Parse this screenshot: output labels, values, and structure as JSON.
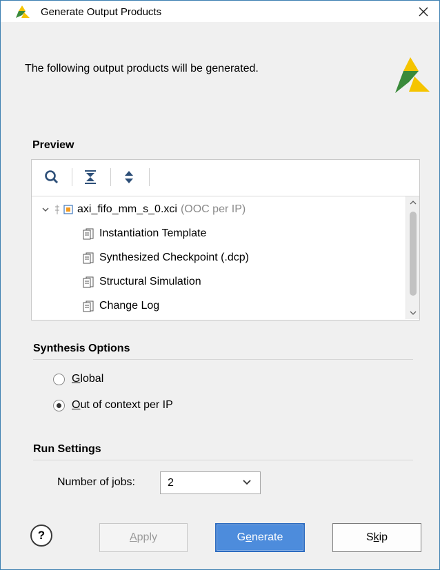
{
  "window": {
    "title": "Generate Output Products",
    "close_icon": "close-icon",
    "logo_icon": "xilinx-logo-icon",
    "brand_colors": {
      "logo_yellow": "#f5c400",
      "logo_green": "#3a8a3a",
      "accent_blue": "#4d8cdc"
    }
  },
  "intro": {
    "text": "The following output products will be generated."
  },
  "preview": {
    "label": "Preview",
    "toolbar": [
      {
        "icon": "search-icon"
      },
      {
        "icon": "collapse-all-icon"
      },
      {
        "icon": "expand-all-icon"
      }
    ],
    "root": {
      "name": "axi_fifo_mm_s_0.xci",
      "suffix": "(OOC per IP)",
      "expanded": true
    },
    "children": [
      {
        "label": "Instantiation Template",
        "icon": "document-icon"
      },
      {
        "label": "Synthesized Checkpoint (.dcp)",
        "icon": "document-icon"
      },
      {
        "label": "Structural Simulation",
        "icon": "document-icon"
      },
      {
        "label": "Change Log",
        "icon": "document-icon"
      }
    ]
  },
  "synthesis_options": {
    "label": "Synthesis Options",
    "options": [
      {
        "label_first": "G",
        "label_rest": "lobal",
        "selected": false
      },
      {
        "label_first": "O",
        "label_rest": "ut of context per IP",
        "selected": true
      }
    ]
  },
  "run_settings": {
    "label": "Run Settings",
    "jobs_label_pre": "Number of ",
    "jobs_label_mnemonic": "j",
    "jobs_label_post": "obs:",
    "jobs_value": "2"
  },
  "buttons": {
    "help": "?",
    "apply_first": "A",
    "apply_rest": "pply",
    "generate_pre": "G",
    "generate_mnemonic": "e",
    "generate_post": "nerate",
    "skip_pre": "S",
    "skip_mnemonic": "k",
    "skip_post": "ip"
  }
}
